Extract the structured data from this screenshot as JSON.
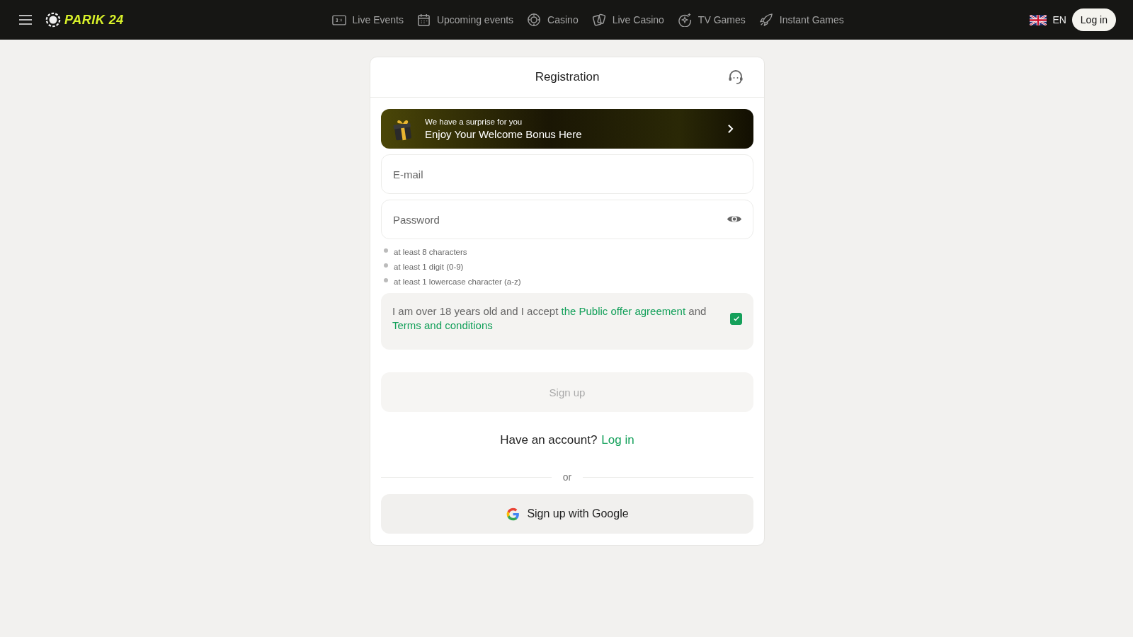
{
  "header": {
    "logo": "PARIK 24",
    "nav": [
      {
        "label": "Live Events"
      },
      {
        "label": "Upcoming events"
      },
      {
        "label": "Casino"
      },
      {
        "label": "Live Casino"
      },
      {
        "label": "TV Games"
      },
      {
        "label": "Instant Games"
      }
    ],
    "language": "EN",
    "login": "Log in"
  },
  "form": {
    "title": "Registration",
    "banner": {
      "subtitle": "We have a surprise for you",
      "title": "Enjoy Your Welcome Bonus Here"
    },
    "email": {
      "placeholder": "E-mail"
    },
    "password": {
      "placeholder": "Password"
    },
    "hints": [
      "at least 8 characters",
      "at least 1 digit (0-9)",
      "at least 1 lowercase character (a-z)"
    ],
    "consent": {
      "text_before": "I am over 18 years old and I accept ",
      "link_1": "the Public offer agreement",
      "text_middle": " and",
      "link_2": "Terms and conditions",
      "checked": true
    },
    "signup": {
      "label": "Sign up",
      "disabled": true
    },
    "account": {
      "question": "Have an account?",
      "link": "Log in"
    },
    "divider": "or",
    "google": "Sign up with Google"
  }
}
